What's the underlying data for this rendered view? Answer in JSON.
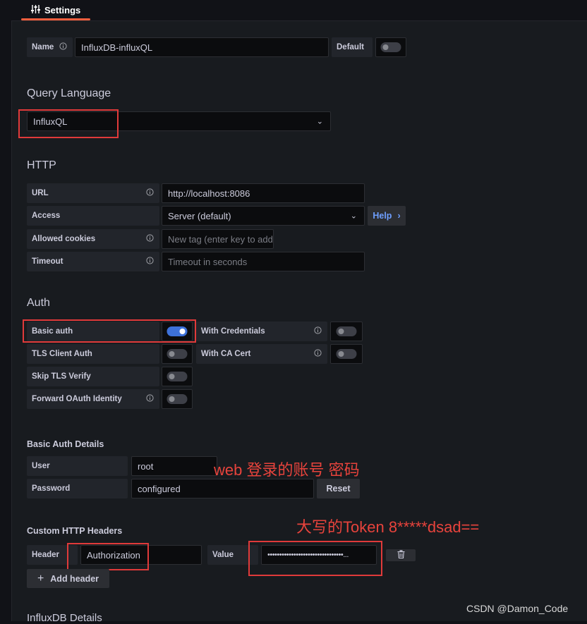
{
  "tab": {
    "label": "Settings",
    "icon": "sliders-icon"
  },
  "name_row": {
    "label": "Name",
    "value": "InfluxDB-influxQL",
    "default_label": "Default",
    "default_on": false
  },
  "query_language": {
    "heading": "Query Language",
    "value": "InfluxQL"
  },
  "http": {
    "heading": "HTTP",
    "url_label": "URL",
    "url_value": "http://localhost:8086",
    "access_label": "Access",
    "access_value": "Server (default)",
    "help_label": "Help",
    "cookies_label": "Allowed cookies",
    "cookies_placeholder": "New tag (enter key to add",
    "timeout_label": "Timeout",
    "timeout_placeholder": "Timeout in seconds"
  },
  "auth": {
    "heading": "Auth",
    "basic_auth": "Basic auth",
    "basic_auth_on": true,
    "with_credentials": "With Credentials",
    "with_credentials_on": false,
    "tls_client_auth": "TLS Client Auth",
    "tls_client_auth_on": false,
    "with_ca_cert": "With CA Cert",
    "with_ca_cert_on": false,
    "skip_tls": "Skip TLS Verify",
    "skip_tls_on": false,
    "forward_oauth": "Forward OAuth Identity",
    "forward_oauth_on": false
  },
  "basic_auth_details": {
    "heading": "Basic Auth Details",
    "user_label": "User",
    "user_value": "root",
    "password_label": "Password",
    "password_value": "configured",
    "reset_label": "Reset"
  },
  "custom_headers": {
    "heading": "Custom HTTP Headers",
    "header_label": "Header",
    "header_value": "Authorization",
    "value_label": "Value",
    "value_value": "••••••••••••••••••••••••••••••••...",
    "add_header_label": "Add header"
  },
  "influxdb_details": {
    "heading": "InfluxDB Details"
  },
  "annotations": {
    "login": "web 登录的账号 密码",
    "token": "大写的Token   8*****dsad==",
    "watermark": "CSDN @Damon_Code"
  },
  "colors": {
    "accent_blue": "#3d71d9",
    "tab_underline": "#f55f3e",
    "annotation_red": "#e03a3a"
  }
}
